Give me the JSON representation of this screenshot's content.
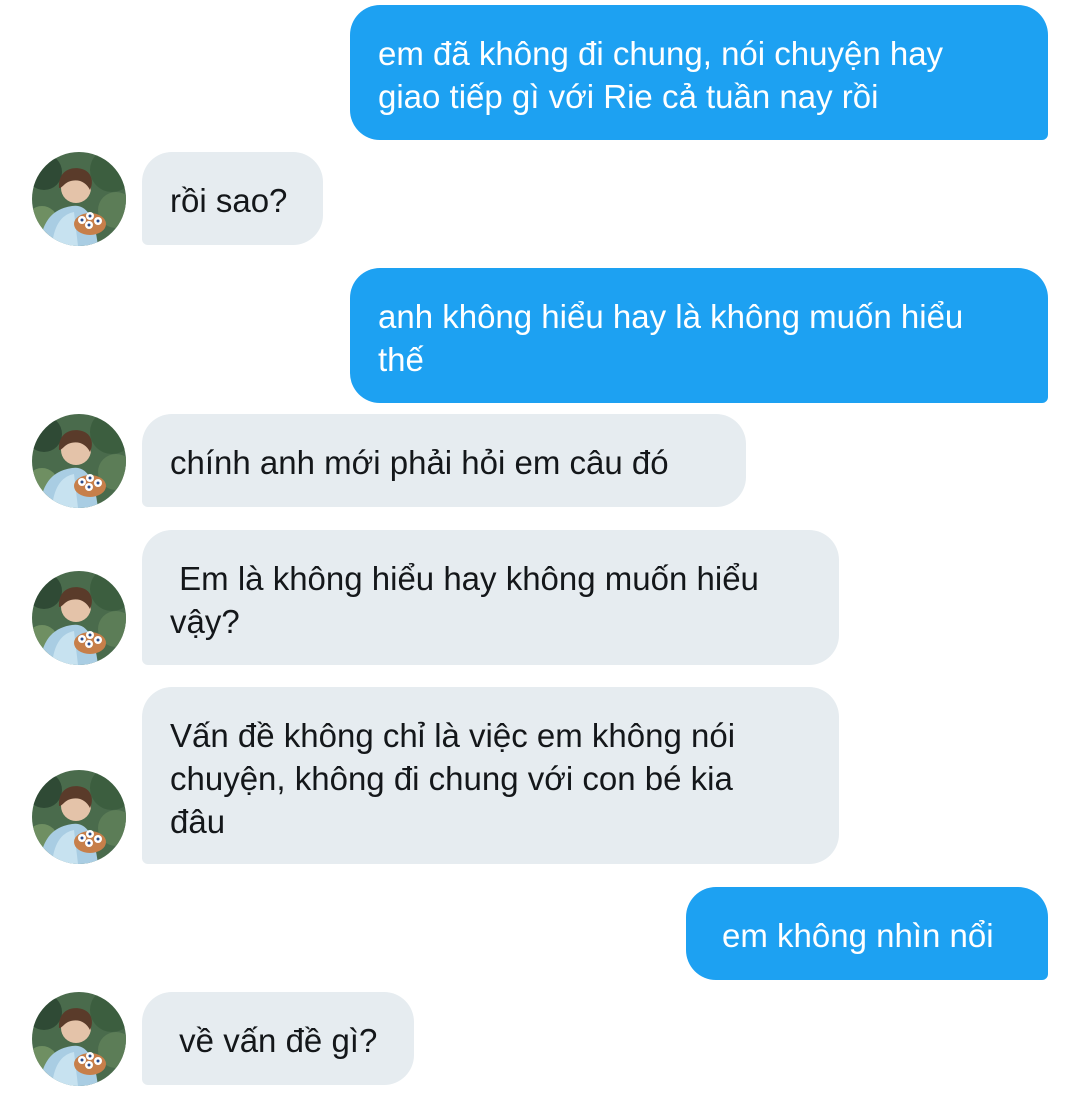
{
  "conversation": {
    "messages": [
      {
        "id": "m1",
        "direction": "outgoing",
        "text": "em đã không đi chung, nói chuyện hay\ngiao tiếp gì với Rie cả tuần nay rồi"
      },
      {
        "id": "m2",
        "direction": "incoming",
        "text": "rồi sao?"
      },
      {
        "id": "m3",
        "direction": "outgoing",
        "text": "anh không hiểu hay là không muốn hiểu\nthế"
      },
      {
        "id": "m4",
        "direction": "incoming",
        "text": "chính anh mới phải hỏi em câu đó"
      },
      {
        "id": "m5",
        "direction": "incoming",
        "text": " Em là không hiểu hay không muốn hiểu\nvậy?"
      },
      {
        "id": "m6",
        "direction": "incoming",
        "text": "Vấn đề không chỉ là việc em không nói\nchuyện, không đi chung với con bé kia\nđâu"
      },
      {
        "id": "m7",
        "direction": "outgoing",
        "text": "em không nhìn nổi"
      },
      {
        "id": "m8",
        "direction": "incoming",
        "text": " về vấn đề gì?"
      }
    ]
  },
  "theme": {
    "outgoing_bubble_color": "#1da1f2",
    "outgoing_text_color": "#ffffff",
    "incoming_bubble_color": "#e6ecf0",
    "incoming_text_color": "#14171a"
  },
  "avatar": {
    "icon": "contact-photo-icon"
  }
}
